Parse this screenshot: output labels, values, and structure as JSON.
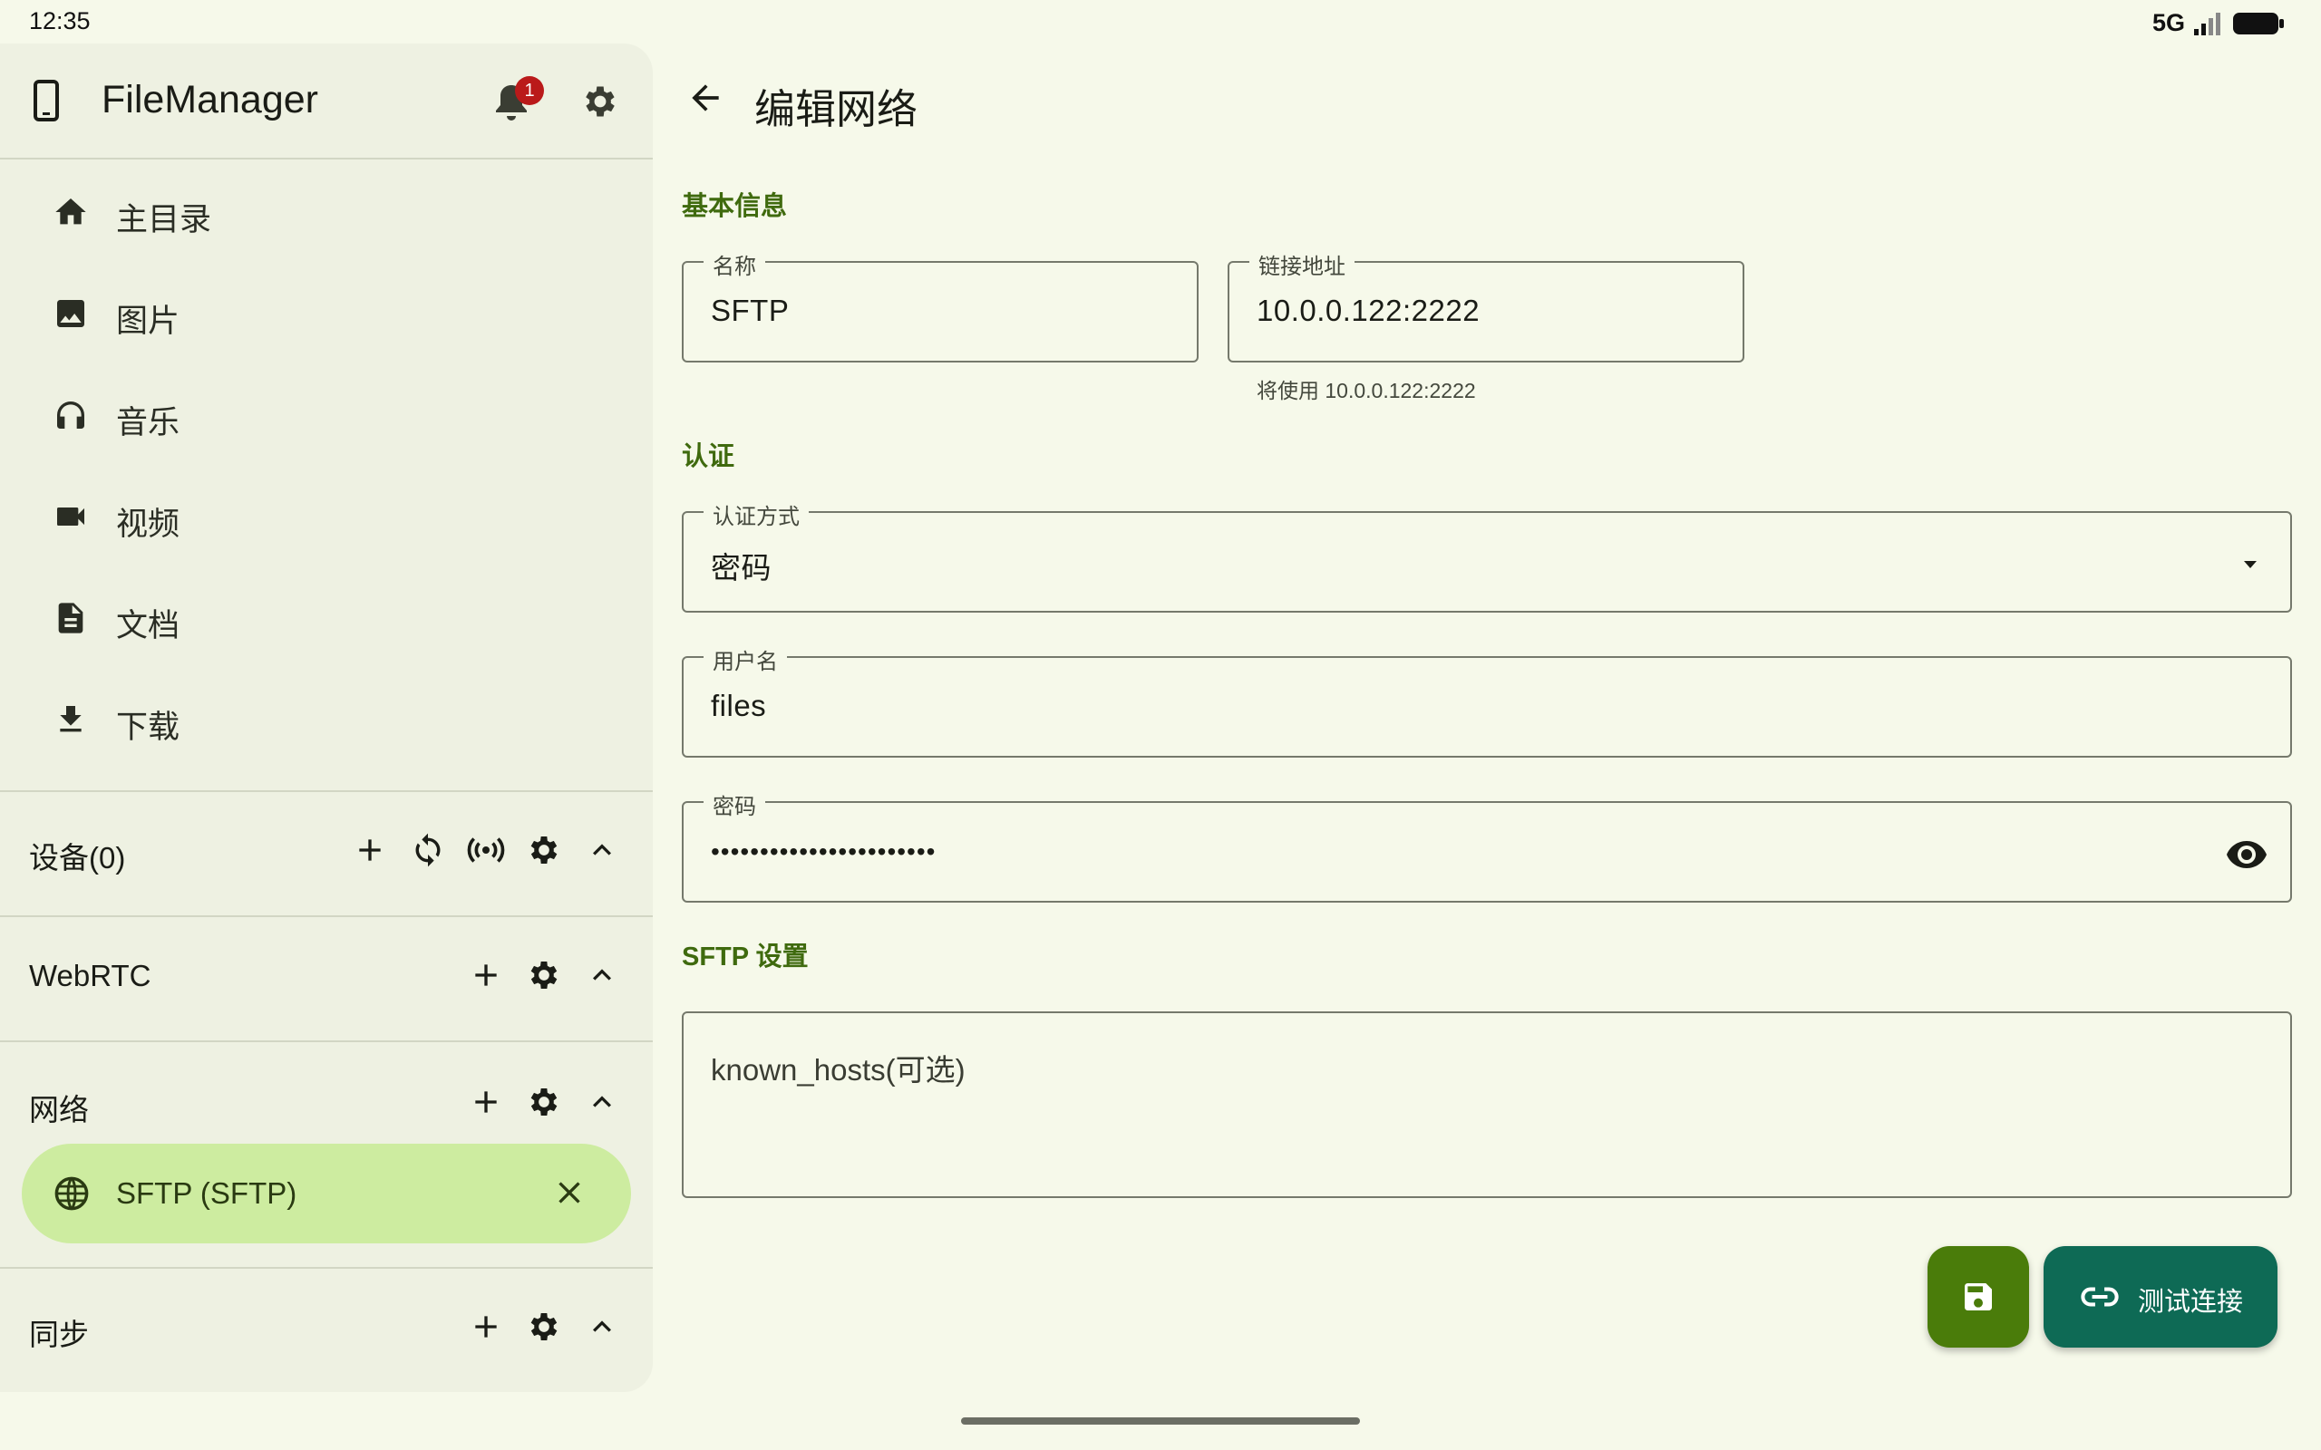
{
  "status_bar": {
    "time": "12:35",
    "network": "5G"
  },
  "sidebar": {
    "app_title": "FileManager",
    "notification_count": "1",
    "nav_items": [
      {
        "label": "主目录",
        "icon": "home-icon"
      },
      {
        "label": "图片",
        "icon": "image-icon"
      },
      {
        "label": "音乐",
        "icon": "headphones-icon"
      },
      {
        "label": "视频",
        "icon": "videocam-icon"
      },
      {
        "label": "文档",
        "icon": "document-icon"
      },
      {
        "label": "下载",
        "icon": "download-icon"
      }
    ],
    "sections": {
      "devices": {
        "title": "设备(0)"
      },
      "webrtc": {
        "title": "WebRTC"
      },
      "network": {
        "title": "网络",
        "items": [
          {
            "label": "SFTP (SFTP)"
          }
        ]
      },
      "sync": {
        "title": "同步"
      }
    }
  },
  "main": {
    "title": "编辑网络",
    "basic_info": {
      "heading": "基本信息",
      "name": {
        "label": "名称",
        "value": "SFTP"
      },
      "address": {
        "label": "链接地址",
        "value": "10.0.0.122:2222",
        "helper": "将使用 10.0.0.122:2222"
      }
    },
    "auth": {
      "heading": "认证",
      "method": {
        "label": "认证方式",
        "value": "密码"
      },
      "username": {
        "label": "用户名",
        "value": "files"
      },
      "password": {
        "label": "密码",
        "value": "•••••••••••••••••••••••"
      }
    },
    "sftp_settings": {
      "heading": "SFTP 设置",
      "known_hosts": {
        "placeholder": "known_hosts(可选)"
      }
    },
    "actions": {
      "test_label": "测试连接"
    }
  },
  "colors": {
    "accent": "#3f6a0e",
    "save_fab": "#4a7c0a",
    "test_fab": "#0e6a55",
    "selected_item": "#cdeca0",
    "badge": "#ba1a1a"
  }
}
